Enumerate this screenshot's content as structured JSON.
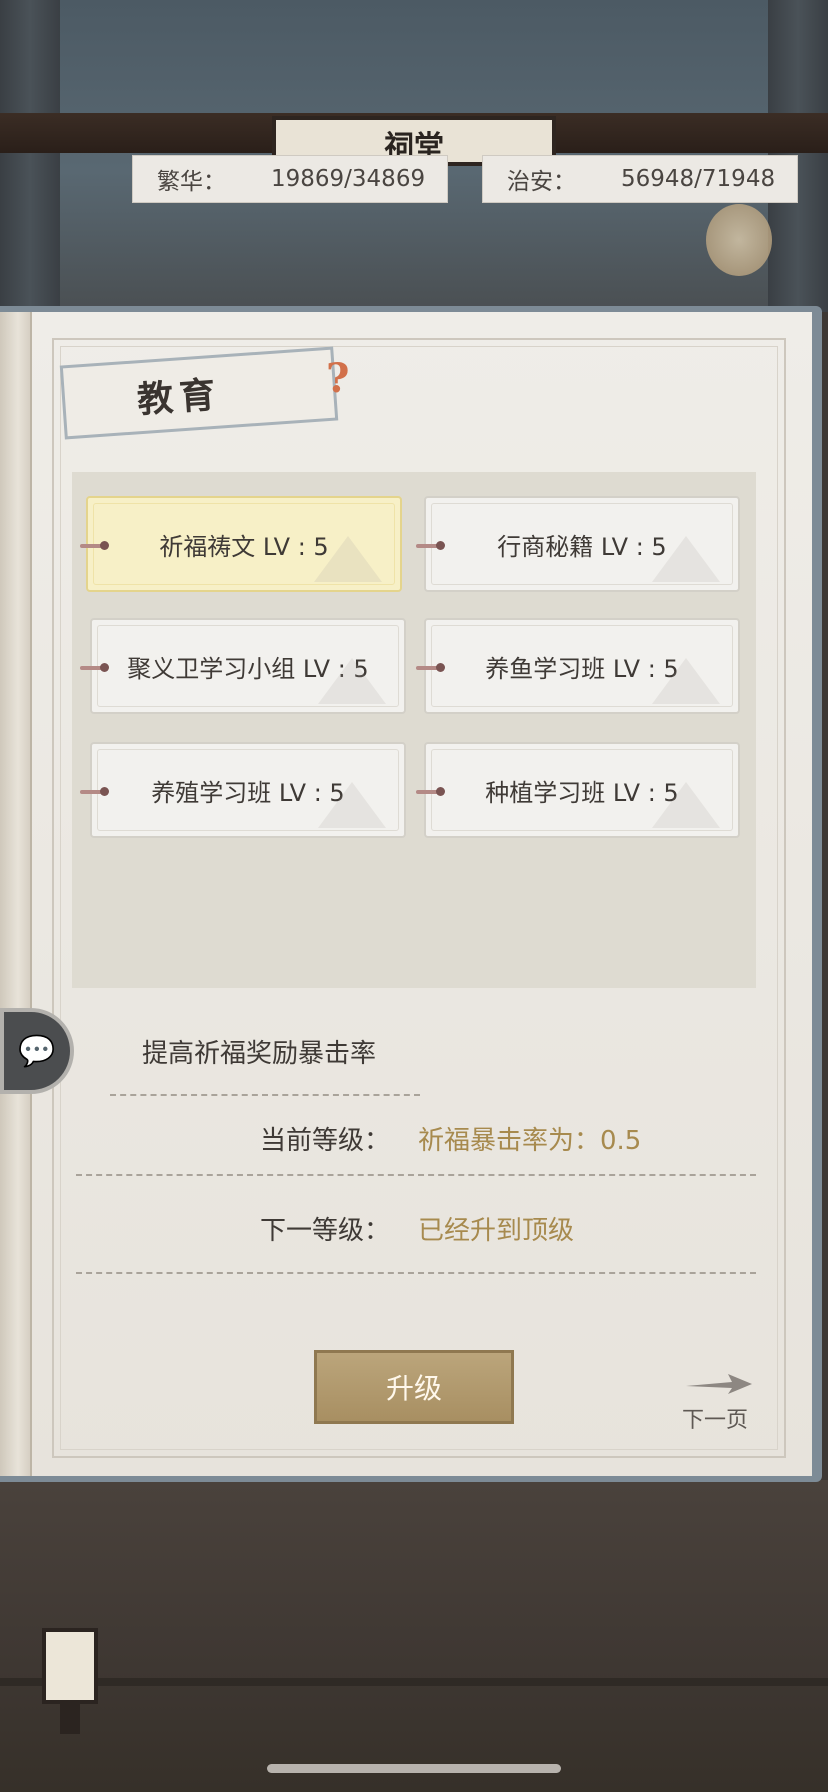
{
  "header": {
    "building_sign": "祠堂",
    "stats": [
      {
        "label": "繁华：",
        "value": "19869/34869"
      },
      {
        "label": "治安：",
        "value": "56948/71948"
      }
    ]
  },
  "panel": {
    "title": "教育",
    "help_icon_glyph": "?",
    "skills": [
      {
        "label": "祈福祷文 LV : 5",
        "selected": true
      },
      {
        "label": "行商秘籍 LV : 5",
        "selected": false
      },
      {
        "label": "聚义卫学习小组 LV : 5",
        "selected": false
      },
      {
        "label": "养鱼学习班 LV : 5",
        "selected": false
      },
      {
        "label": "养殖学习班 LV : 5",
        "selected": false
      },
      {
        "label": "种植学习班 LV : 5",
        "selected": false
      }
    ],
    "description": "提高祈福奖励暴击率",
    "current_level_label": "当前等级：",
    "current_level_value": "祈福暴击率为：0.5",
    "next_level_label": "下一等级：",
    "next_level_value": "已经升到顶级",
    "upgrade_button": "升级",
    "next_page": "下一页"
  },
  "icons": {
    "chat": "chat-bubble-icon",
    "help": "help-question-icon",
    "next": "arrow-right-icon"
  },
  "colors": {
    "selected_skill_bg": "#f7f0c7",
    "value_text": "#a78a4e",
    "upgrade_button": "#b09a6e"
  }
}
